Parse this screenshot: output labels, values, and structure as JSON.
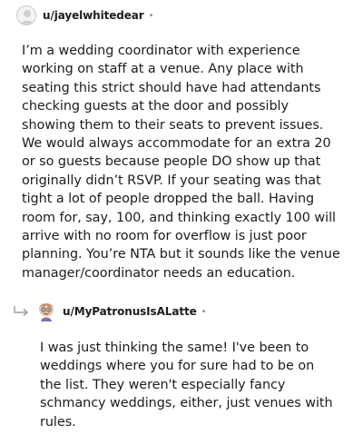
{
  "comments": [
    {
      "username": "u/jayelwhitedear",
      "separator": "•",
      "body": "I’m a wedding coordinator with experience working on staff at a venue. Any place with seating this strict should have had attendants checking guests at the door and possibly showing them to their seats to prevent issues. We would always accommodate for an extra 20 or so guests because people DO show up that originally didn’t RSVP. If your seating was that tight a lot of people dropped the ball. Having room for, say, 100, and thinking exactly 100 will arrive with no room for overflow is just poor planning. You’re NTA but it sounds like the venue manager/coordinator needs an education."
    },
    {
      "username": "u/MyPatronusIsALatte",
      "separator": "•",
      "body": "I was just thinking the same! I've been to weddings where you for sure had to be on the list. They weren't especially fancy schmancy weddings, either, just venues with rules."
    }
  ],
  "icons": {
    "avatar_1": "default-user-avatar-icon",
    "reply": "reply-arrow-icon",
    "avatar_2": "custom-character-avatar-icon"
  }
}
